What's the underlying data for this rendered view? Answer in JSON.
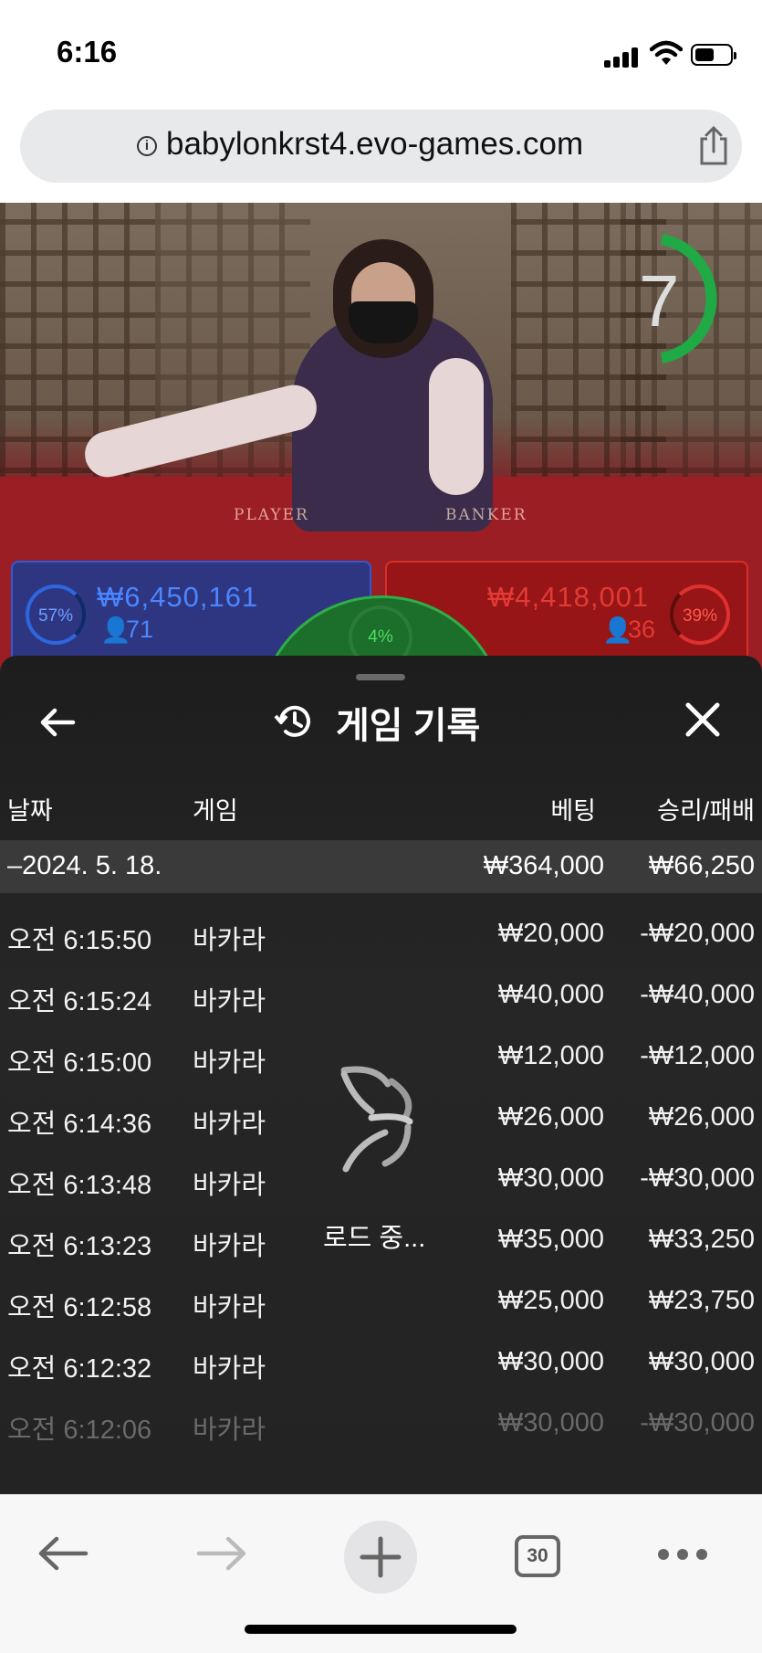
{
  "status_bar": {
    "time": "6:16"
  },
  "browser": {
    "url": "babylonkrst4.evo-games.com"
  },
  "game_overlay": {
    "timer": "7",
    "player": {
      "percent": "57%",
      "amount": "₩6,450,161",
      "count": "71"
    },
    "banker": {
      "percent": "39%",
      "amount": "₩4,418,001",
      "count": "36"
    },
    "tie": {
      "percent": "4%"
    },
    "table_labels": {
      "player": "PLAYER",
      "banker": "BANKER"
    }
  },
  "history_panel": {
    "title": "게임 기록",
    "columns": {
      "date": "날짜",
      "game": "게임",
      "bet": "베팅",
      "result": "승리/패배"
    },
    "date_group": {
      "date": "–2024. 5. 18.",
      "bet_total": "₩364,000",
      "result_total": "₩66,250"
    },
    "rows": [
      {
        "time": "오전 6:15:50",
        "game": "바카라",
        "bet": "₩20,000",
        "result": "-₩20,000"
      },
      {
        "time": "오전 6:15:24",
        "game": "바카라",
        "bet": "₩40,000",
        "result": "-₩40,000"
      },
      {
        "time": "오전 6:15:00",
        "game": "바카라",
        "bet": "₩12,000",
        "result": "-₩12,000"
      },
      {
        "time": "오전 6:14:36",
        "game": "바카라",
        "bet": "₩26,000",
        "result": "₩26,000"
      },
      {
        "time": "오전 6:13:48",
        "game": "바카라",
        "bet": "₩30,000",
        "result": "-₩30,000"
      },
      {
        "time": "오전 6:13:23",
        "game": "바카라",
        "bet": "₩35,000",
        "result": "₩33,250"
      },
      {
        "time": "오전 6:12:58",
        "game": "바카라",
        "bet": "₩25,000",
        "result": "₩23,750"
      },
      {
        "time": "오전 6:12:32",
        "game": "바카라",
        "bet": "₩30,000",
        "result": "₩30,000"
      },
      {
        "time": "오전 6:12:06",
        "game": "바카라",
        "bet": "₩30,000",
        "result": "-₩30,000"
      }
    ],
    "loading_text": "로드 중..."
  },
  "bottom_toolbar": {
    "tab_count": "30"
  },
  "colors": {
    "player_blue": "#2b5bd6",
    "banker_red": "#d6302b",
    "tie_green": "#2fae47",
    "panel_bg": "#232323"
  }
}
